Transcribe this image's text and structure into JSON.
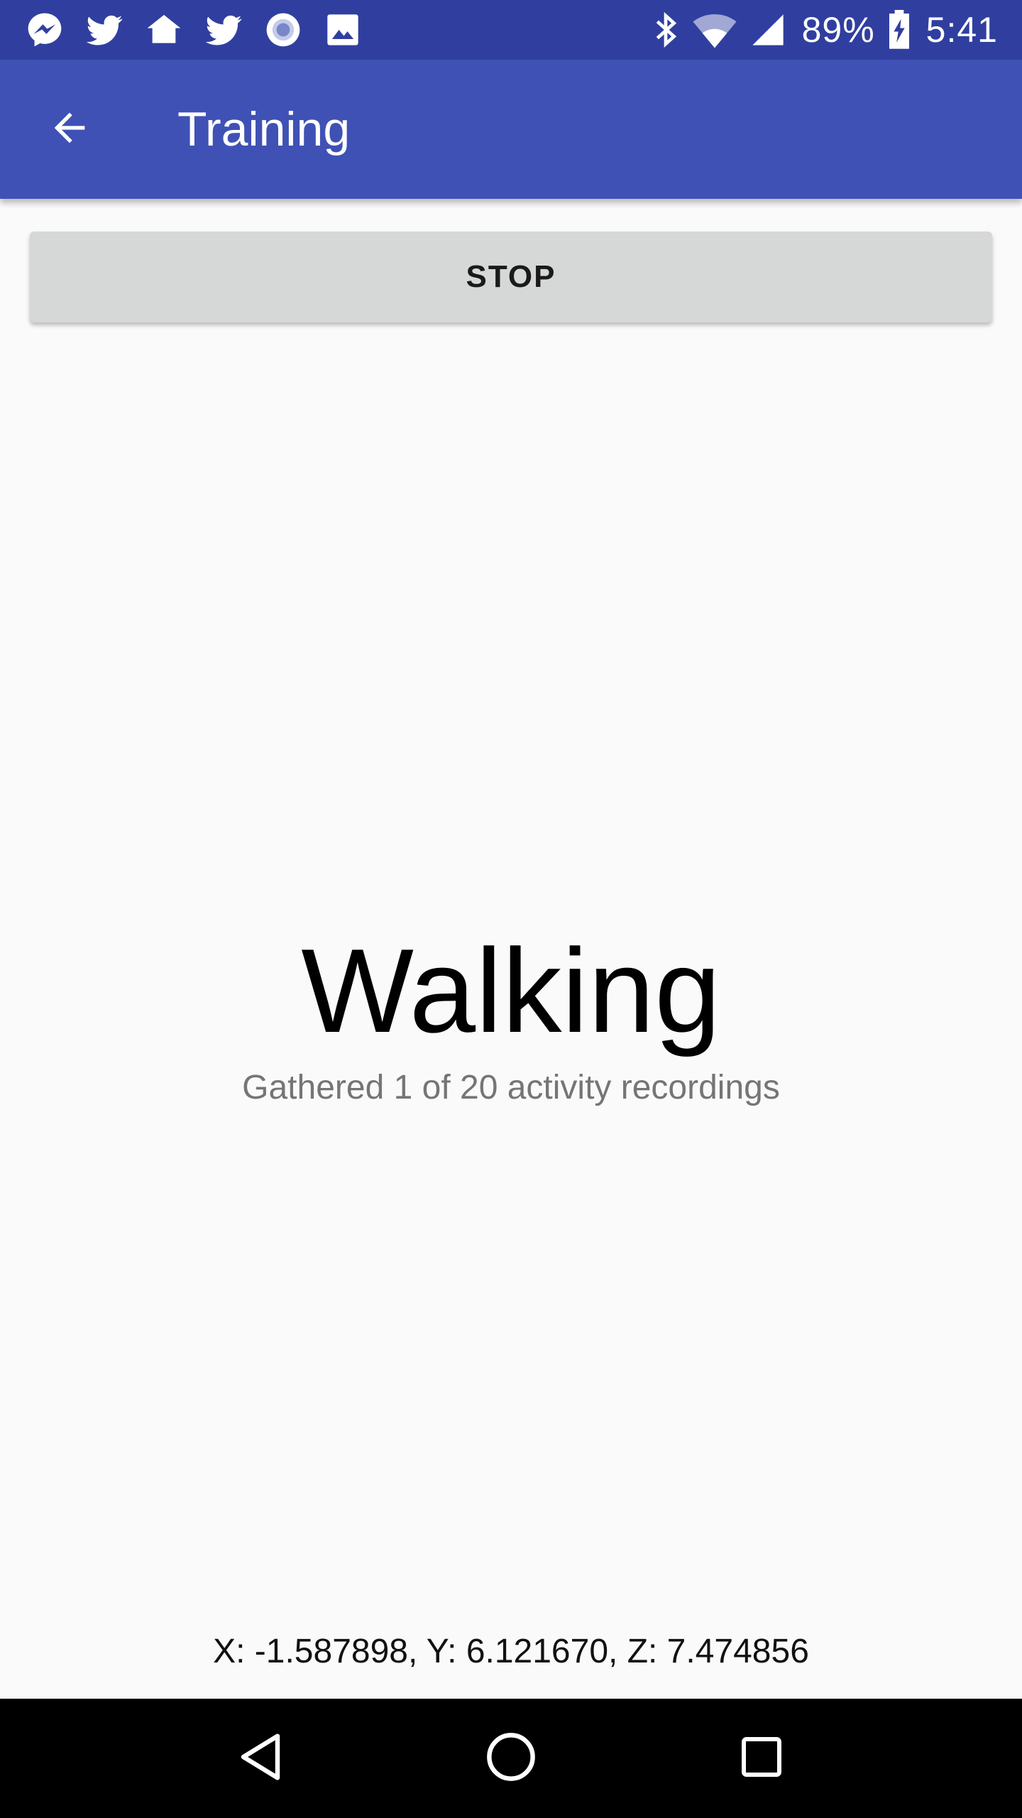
{
  "status_bar": {
    "notification_icons": [
      "messenger-icon",
      "twitter-icon",
      "home-icon",
      "twitter-icon",
      "record-icon",
      "image-icon"
    ],
    "system_icons": [
      "bluetooth-icon",
      "wifi-icon",
      "cell-signal-icon"
    ],
    "battery_percent": "89%",
    "battery_icon": "battery-charging-icon",
    "time": "5:41"
  },
  "app_bar": {
    "back_icon": "arrow-back-icon",
    "title": "Training"
  },
  "actions": {
    "stop_label": "STOP"
  },
  "activity": {
    "name": "Walking",
    "progress_text": "Gathered 1 of 20 activity recordings"
  },
  "sensor": {
    "readout": "X: -1.587898, Y: 6.121670, Z: 7.474856"
  },
  "nav_bar": {
    "buttons": [
      "back-triangle-icon",
      "home-circle-icon",
      "recents-square-icon"
    ]
  },
  "colors": {
    "status_bar": "#303f9f",
    "app_bar": "#3f51b5",
    "background": "#fafafa",
    "button": "#d6d7d7",
    "nav_bar": "#000000"
  }
}
